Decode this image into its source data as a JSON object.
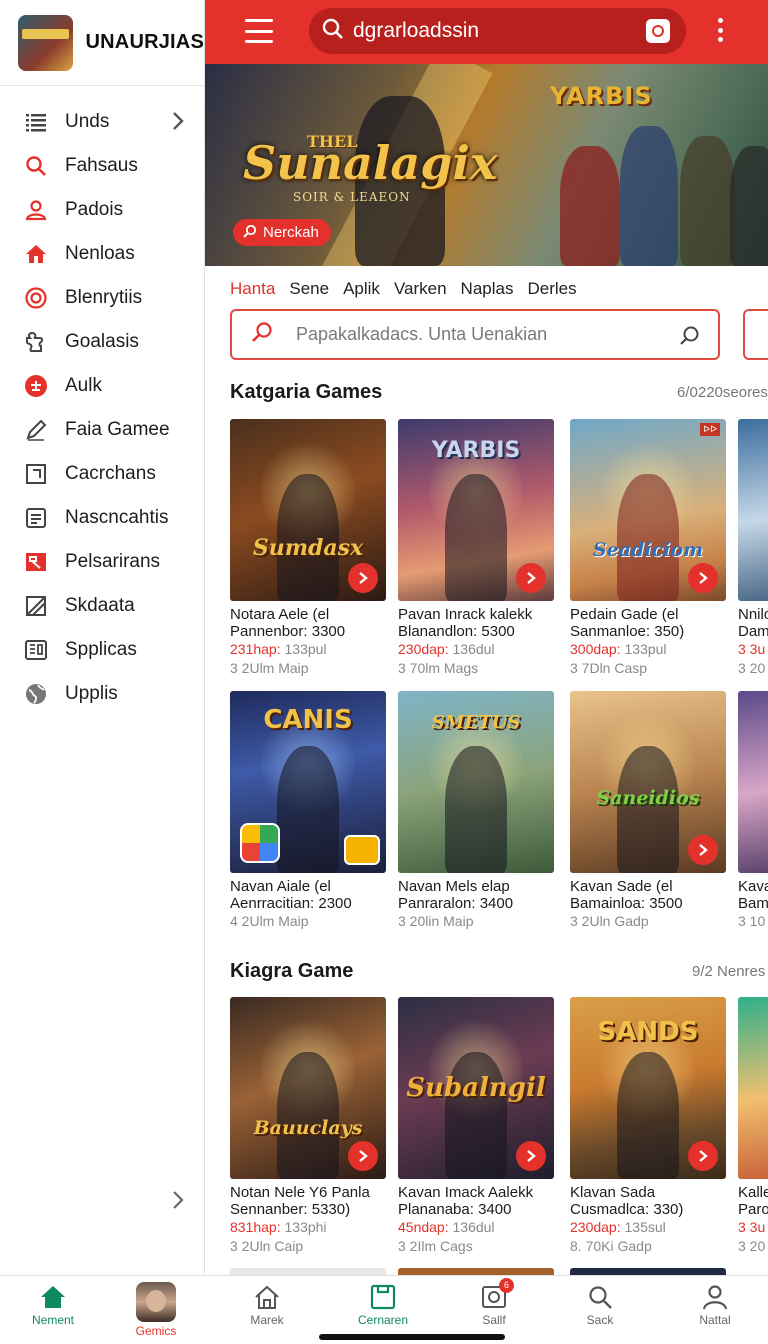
{
  "colors": {
    "accent": "#e4312c",
    "accent_dark": "#b8201e",
    "nav_active": "#0f8a5f"
  },
  "sidebar": {
    "brand": "UNAURJIAS",
    "items": [
      {
        "label": "Unds",
        "icon": "list-icon",
        "has_chevron": true
      },
      {
        "label": "Fahsaus",
        "icon": "search-icon"
      },
      {
        "label": "Padois",
        "icon": "user-icon"
      },
      {
        "label": "Nenloas",
        "icon": "home-icon"
      },
      {
        "label": "Blenrytiis",
        "icon": "target-icon"
      },
      {
        "label": "Goalasis",
        "icon": "puzzle-icon"
      },
      {
        "label": "Aulk",
        "icon": "game-badge-icon"
      },
      {
        "label": "Faia Gamee",
        "icon": "pencil-icon"
      },
      {
        "label": "Cacrchans",
        "icon": "frame-icon"
      },
      {
        "label": "Nascncahtis",
        "icon": "document-icon"
      },
      {
        "label": "Pelsarirans",
        "icon": "flag-icon"
      },
      {
        "label": "Skdaata",
        "icon": "box-icon"
      },
      {
        "label": "Spplicas",
        "icon": "newspaper-icon"
      },
      {
        "label": "Upplis",
        "icon": "globe-icon"
      }
    ]
  },
  "topbar": {
    "search_value": "dgrarloadssin"
  },
  "hero": {
    "title": "Sunalagix",
    "subtitle": "SOIR & LEAEON",
    "overline": "THEL",
    "brand": "YARBIS",
    "badge": "Nerckah"
  },
  "tabs": [
    "Hanta",
    "Sene",
    "Aplik",
    "Varken",
    "Naplas",
    "Derles"
  ],
  "inner_search": {
    "placeholder": "Papakalkadacs. Unta Uenakian"
  },
  "section1": {
    "title": "Katgaria Games",
    "count": "6/0220seores",
    "cards": [
      {
        "l1": "Notara Aele (el",
        "l2": "Pannenbor: 3300",
        "l3a": "231hap:",
        "l3b": "133pul",
        "l4": "3 2Ulm Maip",
        "logo": "Sumdasx"
      },
      {
        "l1": "Pavan Inrack kalekk",
        "l2": "Blanandlon: 5300",
        "l3a": "230dap:",
        "l3b": "136dul",
        "l4": "3 70lm Mags",
        "logo": "YARBIS"
      },
      {
        "l1": "Pedain Gade (el",
        "l2": "Sanmanloe: 350)",
        "l3a": "300dap:",
        "l3b": "133pul",
        "l4": "3 7Dln Casp",
        "logo": "Seadiciom"
      },
      {
        "l1": "Nnilo",
        "l2": "Dam",
        "l3a": "3 3u",
        "l3b": "",
        "l4": "3 20",
        "logo": ""
      }
    ]
  },
  "section1_row2": {
    "cards": [
      {
        "l1": "Navan Aiale (el",
        "l2": "Aenrracitian: 2300",
        "l4": "4 2Ulm Maip",
        "logo": "CANIS"
      },
      {
        "l1": "Navan Mels elap",
        "l2": "Panraralon: 3400",
        "l4": "3 20lin Maip",
        "logo": "SMETUS"
      },
      {
        "l1": "Kavan Sade (el",
        "l2": "Bamainloa: 3500",
        "l4": "3 2Uln Gadp",
        "logo": "Saneidios"
      },
      {
        "l1": "Kava",
        "l2": "Bam",
        "l4": "3 10",
        "logo": ""
      }
    ]
  },
  "section2": {
    "title": "Kiagra Game",
    "count": "9/2 Nenres",
    "cards": [
      {
        "l1": "Notan Nele Y6 Panla",
        "l2": "Sennanber: 5330)",
        "l3a": "831hap:",
        "l3b": "133phi",
        "l4": "3 2Uln Caip",
        "logo": "Bauuclays"
      },
      {
        "l1": "Kavan Imack Aalekk",
        "l2": "Plananaba: 3400",
        "l3a": "45ndap:",
        "l3b": "136dul",
        "l4": "3 2Ilm Cags",
        "logo": "Subalngil"
      },
      {
        "l1": "Klavan Sada",
        "l2": "Cusmadlca: 330)",
        "l3a": "230dap:",
        "l3b": "135sul",
        "l4": "8. 70Ki Gadp",
        "logo": "SANDS"
      },
      {
        "l1": "Kalle",
        "l2": "Paro",
        "l3a": "3 3u",
        "l3b": "",
        "l4": "3 20",
        "logo": ""
      }
    ]
  },
  "bottom_nav": [
    {
      "label": "Nement",
      "icon": "home-icon",
      "active": true
    },
    {
      "label": "Gemics",
      "icon": "avatar"
    },
    {
      "label": "Marek",
      "icon": "house-outline-icon"
    },
    {
      "label": "Cernaren",
      "icon": "bookmark-frame-icon",
      "active": true
    },
    {
      "label": "Sallf",
      "icon": "gallery-icon",
      "badge": "6"
    },
    {
      "label": "Sack",
      "icon": "search-icon"
    },
    {
      "label": "Nattal",
      "icon": "person-icon"
    }
  ]
}
